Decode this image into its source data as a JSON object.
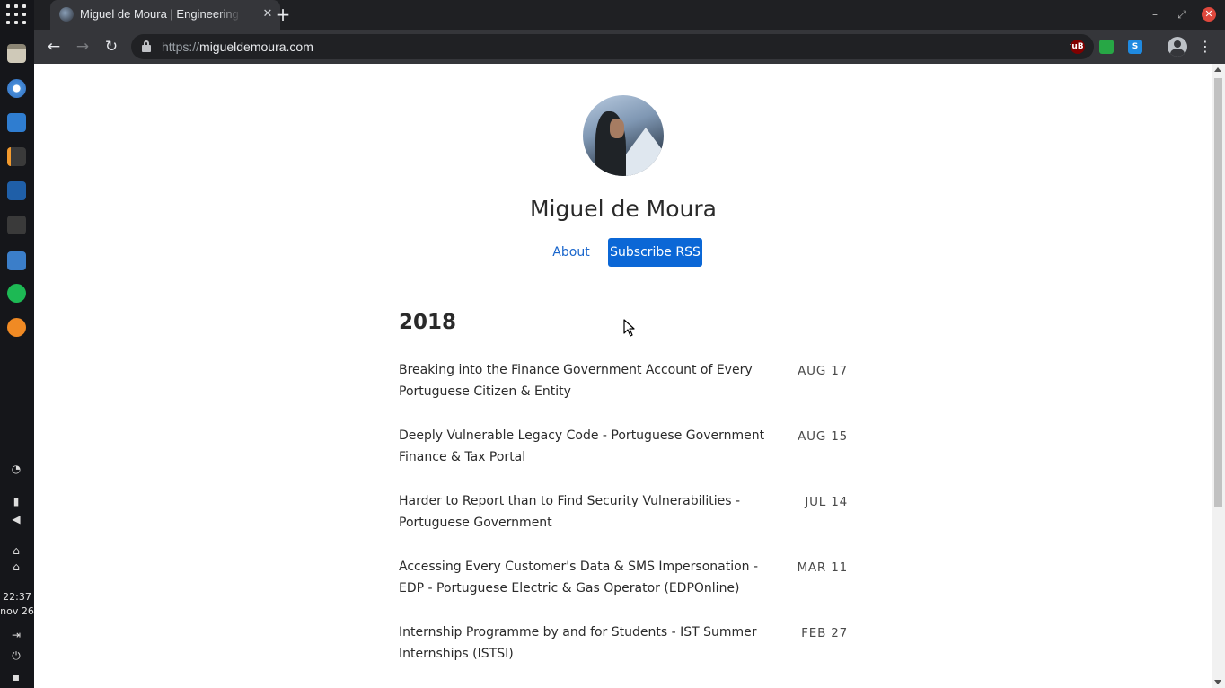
{
  "dock": {
    "apps": [
      "files",
      "chromium",
      "messages",
      "sublime-text",
      "vscode",
      "terminal",
      "screenshot",
      "spotify",
      "podcast"
    ],
    "clock_time": "22:37",
    "clock_date": "nov 26"
  },
  "browser": {
    "tab_title": "Miguel de Moura | Engineering",
    "tab_close": "✕",
    "new_tab": "+",
    "url_scheme": "https://",
    "url_host": "migueldemoura.com",
    "extensions": [
      "uB",
      "",
      "S"
    ],
    "window_controls": [
      "–",
      "⤢",
      "✕"
    ]
  },
  "site": {
    "name": "Miguel de Moura",
    "nav": {
      "about": "About",
      "subscribe": "Subscribe RSS"
    },
    "year": "2018",
    "posts": [
      {
        "title": "Breaking into the Finance Government Account of Every Portuguese Citizen & Entity",
        "date": "AUG 17"
      },
      {
        "title": "Deeply Vulnerable Legacy Code - Portuguese Government Finance & Tax Portal",
        "date": "AUG 15"
      },
      {
        "title": "Harder to Report than to Find Security Vulnerabilities - Portuguese Government",
        "date": "JUL 14"
      },
      {
        "title": "Accessing Every Customer's Data & SMS Impersonation - EDP - Portuguese Electric & Gas Operator (EDPOnline)",
        "date": "MAR 11"
      },
      {
        "title": "Internship Programme by and for Students - IST Summer Internships (ISTSI)",
        "date": "FEB 27"
      }
    ]
  },
  "colors": {
    "link": "#1a66cc",
    "button": "#0b67d6",
    "chrome_dark": "#35363a"
  }
}
